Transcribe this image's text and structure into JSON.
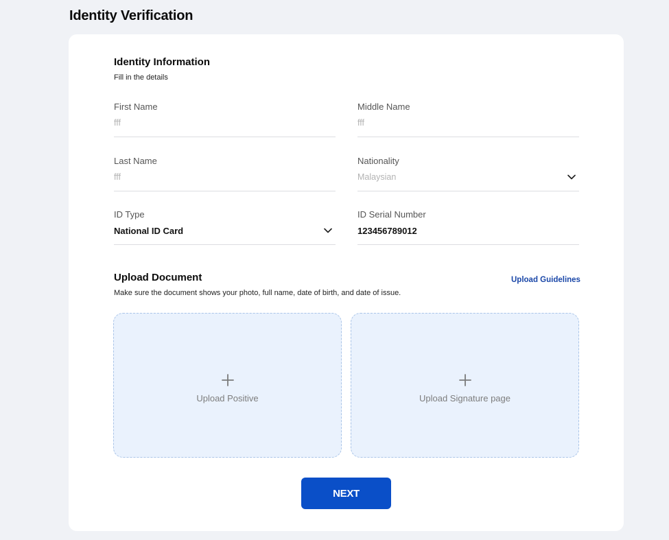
{
  "page": {
    "title": "Identity Verification"
  },
  "identity": {
    "title": "Identity Information",
    "subtitle": "Fill in the details",
    "fields": {
      "first_name": {
        "label": "First Name",
        "value": "fff"
      },
      "middle_name": {
        "label": "Middle Name",
        "value": "fff"
      },
      "last_name": {
        "label": "Last Name",
        "value": "fff"
      },
      "nationality": {
        "label": "Nationality",
        "value": "Malaysian"
      },
      "id_type": {
        "label": "ID Type",
        "value": "National ID Card"
      },
      "id_serial": {
        "label": "ID Serial Number",
        "value": "123456789012"
      }
    }
  },
  "upload": {
    "title": "Upload Document",
    "subtitle": "Make sure the document shows your photo, full name, date of birth, and date of issue.",
    "guidelines_link": "Upload Guidelines",
    "positive_label": "Upload Positive",
    "signature_label": "Upload Signature page"
  },
  "actions": {
    "next_label": "NEXT"
  },
  "icons": {
    "dropdown": "chevron-down-icon",
    "add": "plus-icon"
  },
  "colors": {
    "primary": "#0a4fc8",
    "link": "#1a47a8",
    "upload_bg": "#eaf2fd"
  }
}
